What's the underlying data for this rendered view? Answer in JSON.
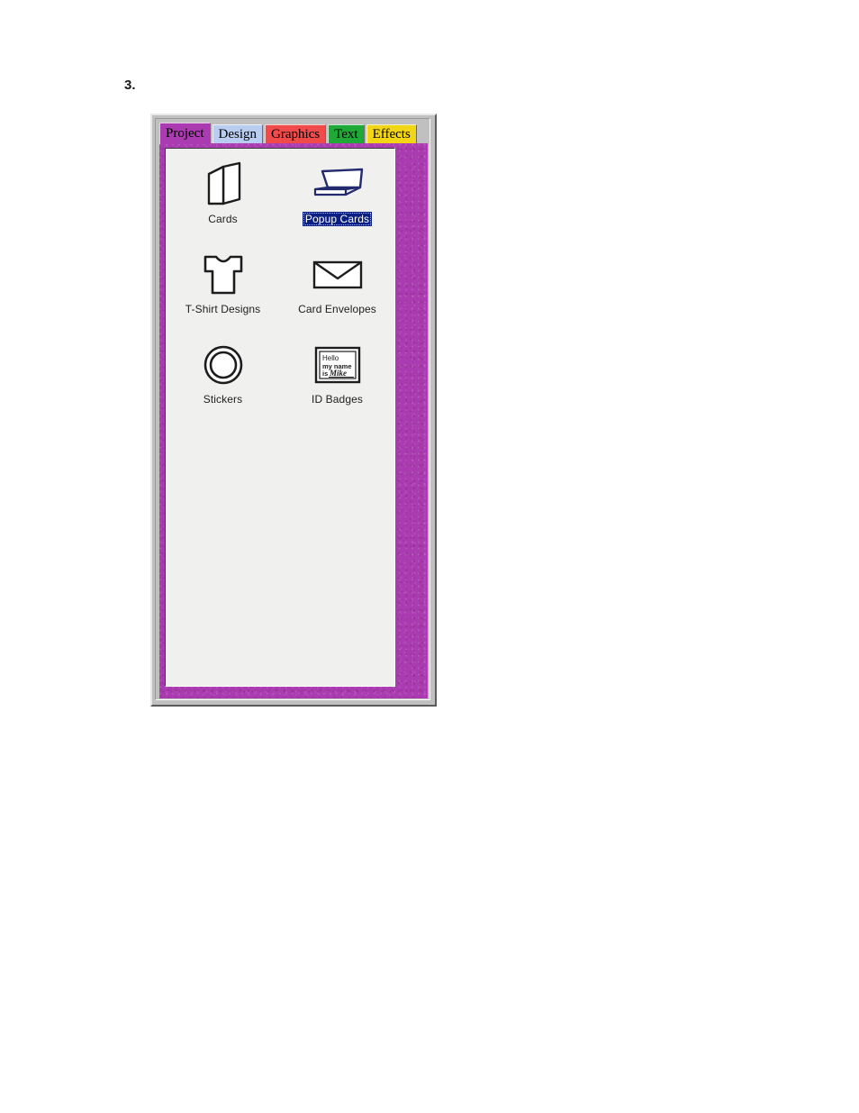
{
  "document": {
    "list_marker": "3."
  },
  "window": {
    "name": "project-panel-window",
    "frame_color": "#c0c0c0",
    "body_color": "#ab3bb0",
    "panel_color": "#f0f0ee"
  },
  "tabs": [
    {
      "label": "Project",
      "icon": "tab-project",
      "color": "#ab3bb0",
      "text_color": "#000000",
      "active": true
    },
    {
      "label": "Design",
      "icon": "tab-design",
      "color": "#b9cdf0",
      "text_color": "#000000",
      "active": false
    },
    {
      "label": "Graphics",
      "icon": "tab-graphics",
      "color": "#f04a4a",
      "text_color": "#000000",
      "active": false
    },
    {
      "label": "Text",
      "icon": "tab-text",
      "color": "#1faa38",
      "text_color": "#000000",
      "active": false
    },
    {
      "label": "Effects",
      "icon": "tab-effects",
      "color": "#f2d615",
      "text_color": "#000000",
      "active": false
    }
  ],
  "project_items": [
    {
      "label": "Cards",
      "icon": "folded-card-icon",
      "selected": false
    },
    {
      "label": "Popup Cards",
      "icon": "popup-card-icon",
      "selected": true
    },
    {
      "label": "T-Shirt Designs",
      "icon": "tshirt-icon",
      "selected": false
    },
    {
      "label": "Card Envelopes",
      "icon": "envelope-icon",
      "selected": false
    },
    {
      "label": "Stickers",
      "icon": "sticker-ring-icon",
      "selected": false
    },
    {
      "label": "ID Badges",
      "icon": "id-badge-icon",
      "selected": false
    }
  ],
  "id_badge_icon_text": {
    "line1": "Hello",
    "line2": "my name",
    "line3": "is",
    "name": "Mike"
  },
  "colors": {
    "selection_background": "#0b1f82",
    "selection_text": "#ffffff",
    "icon_outline": "#1d1d1d",
    "popup_card_outline": "#232a6e"
  }
}
